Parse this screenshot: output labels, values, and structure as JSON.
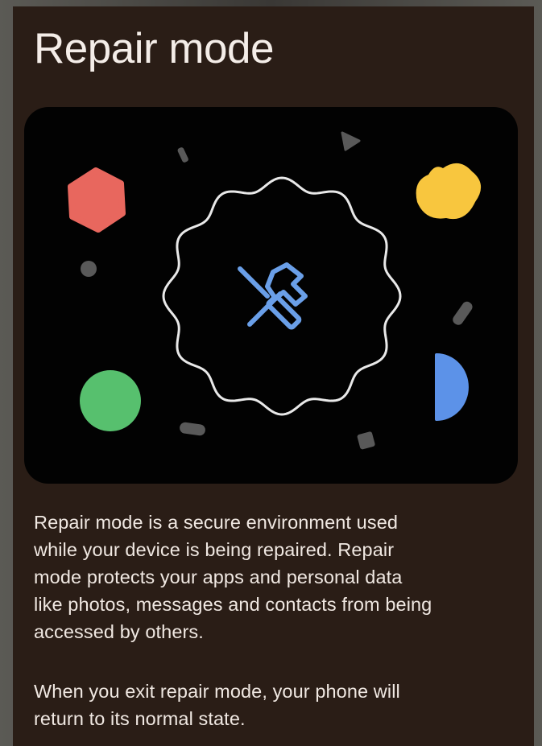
{
  "screen": {
    "title": "Repair mode",
    "description_lines": [
      "Repair mode is a secure environment used",
      "while your device is being repaired. Repair",
      "mode protects your apps and personal data",
      "like photos, messages and contacts from being",
      "accessed by others."
    ],
    "exit_lines": [
      "When you exit repair mode, your phone will",
      "return to its normal state."
    ]
  },
  "illustration": {
    "icon": "repair-tools-icon",
    "colors": {
      "hexagon": "#e8675e",
      "squircle": "#f8c63e",
      "circle": "#57c06e",
      "half_circle": "#5c92e8",
      "tools": "#6a9fe8",
      "outline": "#e9e9e9",
      "confetti": "#595959"
    }
  }
}
